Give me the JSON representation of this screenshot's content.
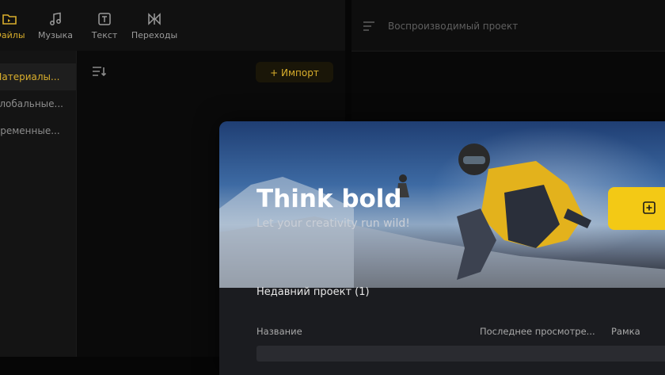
{
  "tabs": [
    {
      "label": "Файлы",
      "icon": "folder-icon"
    },
    {
      "label": "Музыка",
      "icon": "music-note-icon"
    },
    {
      "label": "Текст",
      "icon": "text-t-icon"
    },
    {
      "label": "Переходы",
      "icon": "transition-icon"
    }
  ],
  "sidebar": {
    "items": [
      {
        "label": "Материалы..."
      },
      {
        "label": "Глобальные..."
      },
      {
        "label": "Временные..."
      }
    ]
  },
  "toolbar": {
    "import_label": "+ Импорт",
    "sort_icon": "sort-icon"
  },
  "player": {
    "title": "Воспроизводимый проект",
    "menu_icon": "menu-lines-icon"
  },
  "welcome": {
    "title": "Think bold",
    "subtitle": "Let your creativity run wild!",
    "new_project_icon": "plus-square-icon",
    "recent_title": "Недавний проект (1)",
    "columns": {
      "name": "Название",
      "last_viewed": "Последнее просмотре...",
      "frame": "Рамка"
    }
  },
  "colors": {
    "accent": "#d9ae2c",
    "button_yellow": "#f3c915",
    "background": "#060606"
  }
}
